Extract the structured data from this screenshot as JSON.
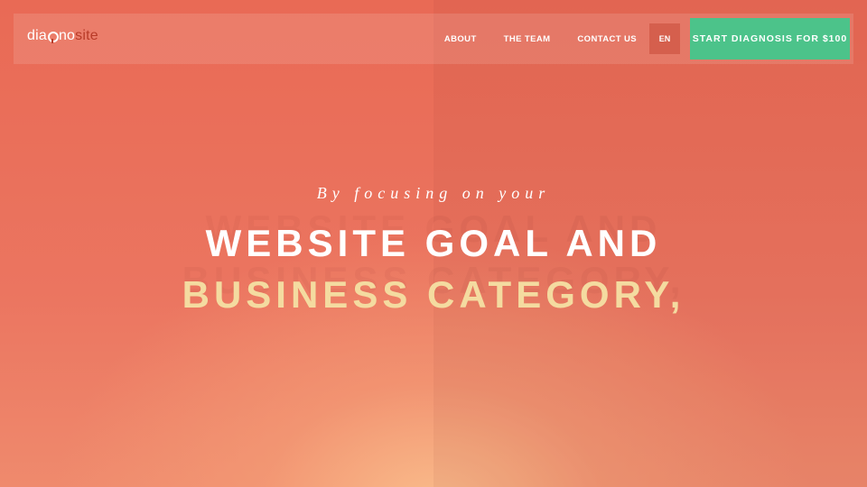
{
  "brand": {
    "logo_part1": "dia",
    "logo_part2": "no",
    "logo_part3": "site",
    "icon": "magnifier-icon"
  },
  "nav": {
    "items": [
      {
        "label": "ABOUT"
      },
      {
        "label": "THE TEAM"
      },
      {
        "label": "CONTACT US"
      }
    ],
    "language": "EN",
    "cta": "START DIAGNOSIS FOR $100"
  },
  "hero": {
    "tagline": "By focusing on your",
    "line1": "WEBSITE GOAL AND",
    "line2": "BUSINESS CATEGORY,"
  },
  "colors": {
    "background": "#ea6c57",
    "cta": "#4cc38a",
    "highlight_text": "#f4dba0",
    "logo_accent": "#b83b28",
    "language_button": "#d55f4d"
  }
}
